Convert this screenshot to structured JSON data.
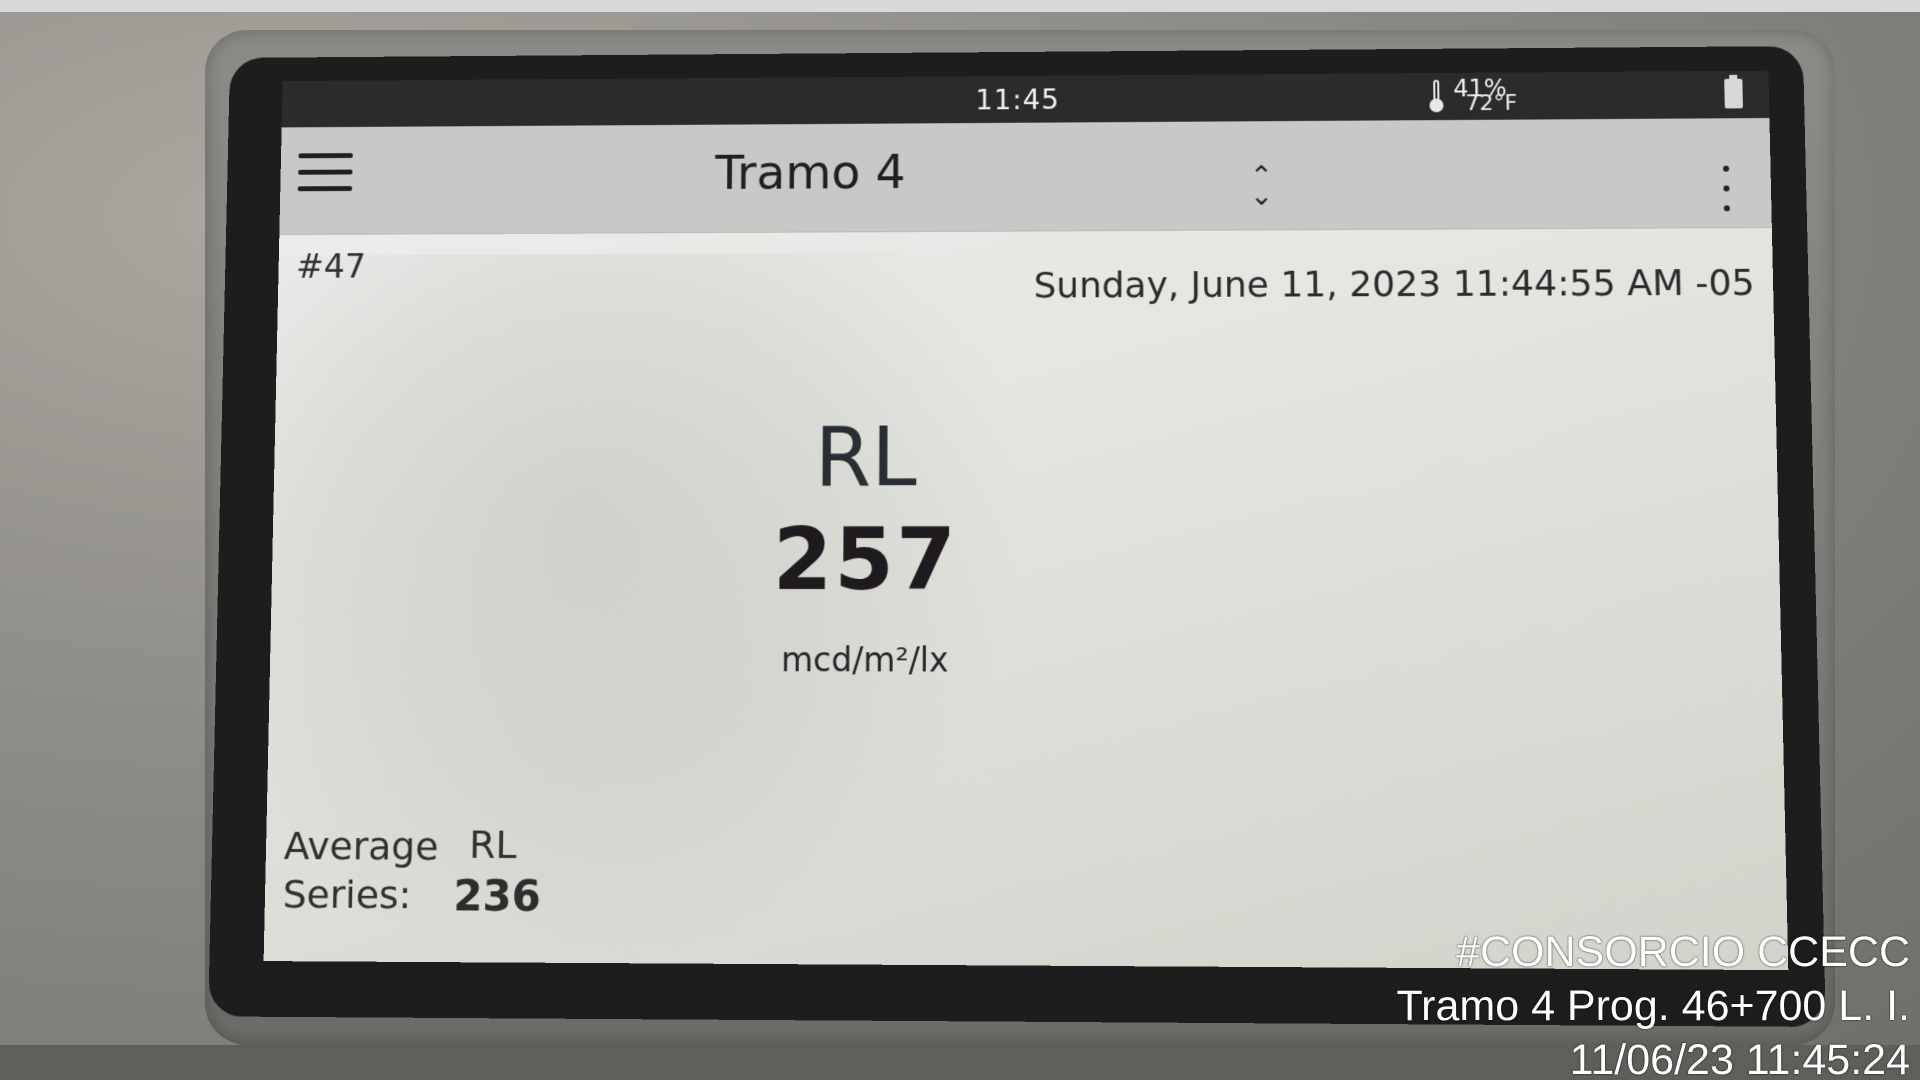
{
  "status_bar": {
    "time": "11:45",
    "humidity": "41%",
    "temperature": "72°F"
  },
  "app_bar": {
    "title": "Tramo 4"
  },
  "record": {
    "number": "#47",
    "timestamp": "Sunday, June 11, 2023 11:44:55 AM -05"
  },
  "measurement": {
    "label": "RL",
    "value": "257",
    "unit": "mcd/m²/lx"
  },
  "average_series": {
    "label_line_1": "Average",
    "label_line_2": "Series:",
    "metric": "RL",
    "value": "236"
  },
  "photo_overlay": {
    "line_1": "#CONSORCIO CCECC",
    "line_2": "Tramo 4 Prog. 46+700 L. I.",
    "line_3": "11/06/23  11:45:24"
  },
  "icons": {
    "menu": "hamburger-menu-icon",
    "sort": "sort-updown-icon",
    "overflow": "more-vertical-icon",
    "thermometer": "thermometer-icon",
    "battery": "battery-icon"
  }
}
